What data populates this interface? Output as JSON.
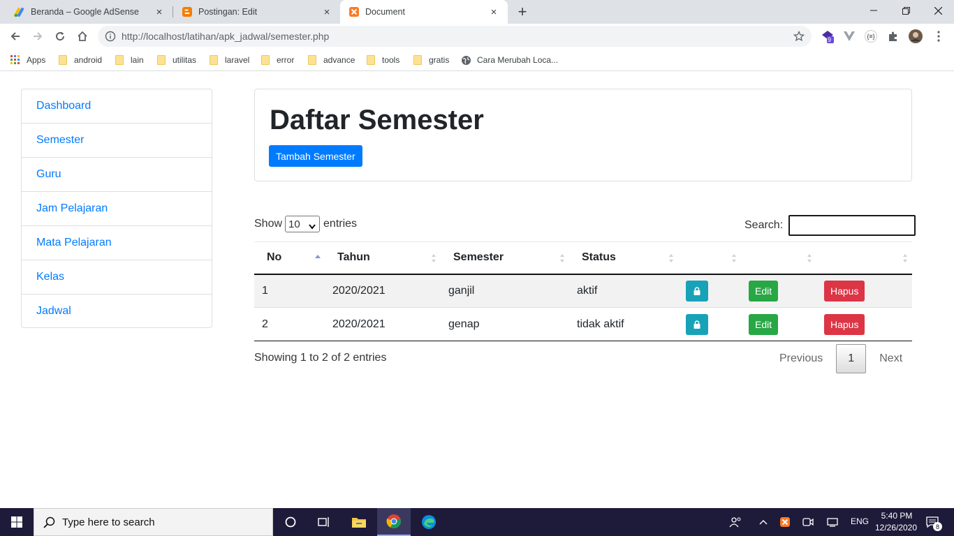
{
  "browser": {
    "tabs": [
      {
        "title": "Beranda – Google AdSense",
        "close": "×"
      },
      {
        "title": "Postingan: Edit",
        "close": "×"
      },
      {
        "title": "Document",
        "close": "×"
      }
    ],
    "new_tab": "+",
    "url": "http://localhost/latihan/apk_jadwal/semester.php",
    "extension_badge": "9",
    "extension_json": "{≡}",
    "bookmarks": [
      "Apps",
      "android",
      "lain",
      "utilitas",
      "laravel",
      "error",
      "advance",
      "tools",
      "gratis",
      "Cara Merubah Loca..."
    ]
  },
  "sidebar": {
    "items": [
      "Dashboard",
      "Semester",
      "Guru",
      "Jam Pelajaran",
      "Mata Pelajaran",
      "Kelas",
      "Jadwal"
    ]
  },
  "header": {
    "title": "Daftar Semester",
    "add_button": "Tambah Semester"
  },
  "table_controls": {
    "show_label": "Show",
    "entries_value": "10",
    "entries_label": "entries",
    "search_label": "Search:"
  },
  "table": {
    "columns": [
      "No",
      "Tahun",
      "Semester",
      "Status",
      "",
      "",
      ""
    ],
    "rows": [
      {
        "no": "1",
        "tahun": "2020/2021",
        "semester": "ganjil",
        "status": "aktif",
        "edit": "Edit",
        "delete": "Hapus"
      },
      {
        "no": "2",
        "tahun": "2020/2021",
        "semester": "genap",
        "status": "tidak aktif",
        "edit": "Edit",
        "delete": "Hapus"
      }
    ]
  },
  "footer": {
    "info": "Showing 1 to 2 of 2 entries",
    "previous": "Previous",
    "current_page": "1",
    "next": "Next"
  },
  "taskbar": {
    "search_placeholder": "Type here to search",
    "language": "ENG",
    "time": "5:40 PM",
    "date": "12/26/2020",
    "notification_count": "8"
  },
  "colors": {
    "primary": "#007bff",
    "info": "#17a2b8",
    "success": "#28a745",
    "danger": "#dc3545",
    "taskbar": "#1e1a3a"
  }
}
